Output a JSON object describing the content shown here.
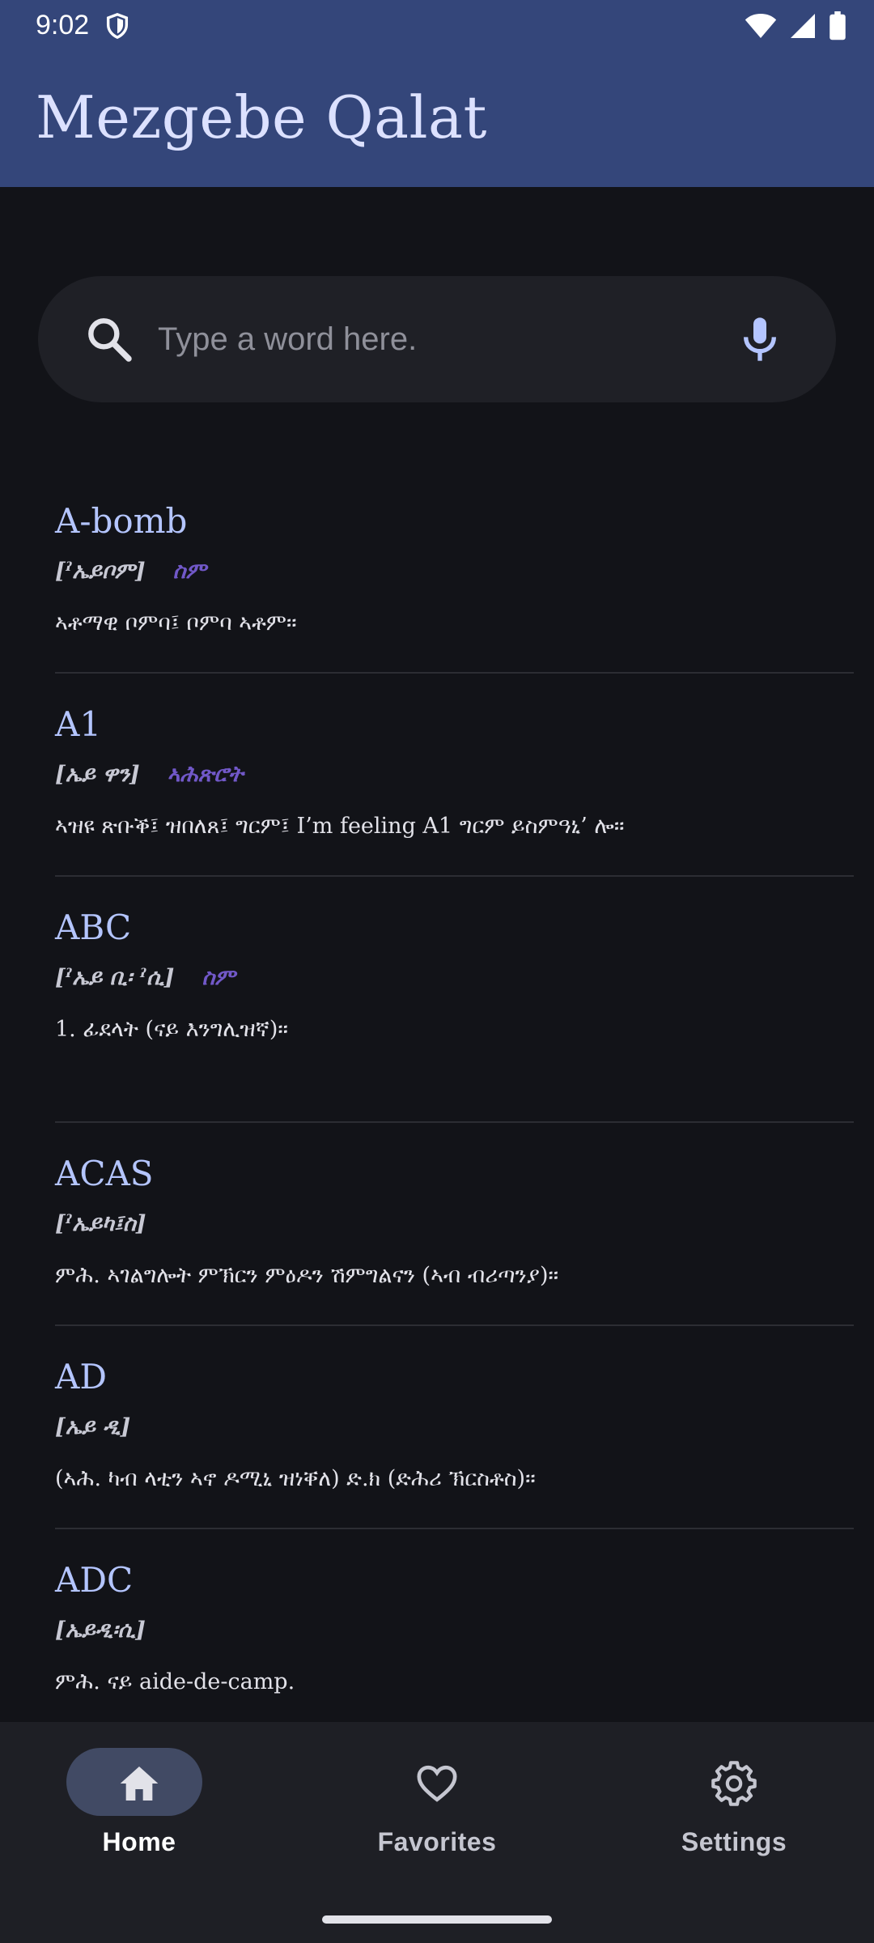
{
  "status_bar": {
    "time": "9:02",
    "icons": [
      "shield-icon",
      "wifi-icon",
      "signal-icon",
      "battery-icon"
    ]
  },
  "app_bar": {
    "title": "Mezgebe Qalat"
  },
  "search": {
    "placeholder": "Type a word here.",
    "value": "",
    "leading_icon": "search-icon",
    "trailing_icon": "mic-icon"
  },
  "entries": [
    {
      "word": "A-bomb",
      "pron": "[ˀኤይቦም]",
      "pos": "ስም",
      "def": "ኣቶማዊ ቦምባ፤ ቦምባ ኣቶም።"
    },
    {
      "word": "A1",
      "pron": "[ኤይ ዋን]",
      "pos": "ኣሕጽሮት",
      "def": "ኣዝዩ ጽቡቕ፤ ዝበለጸ፤ ግርም፤ I’m feeling A1 ግርም ይስምዓኒ’ ሎ።"
    },
    {
      "word": "ABC",
      "pron": "[ˀኤይ ቢ፡ ˀሲ]",
      "pos": "ስም",
      "def": "1. ፊደላት (ናይ እንግሊዝኛ)።"
    },
    {
      "word": "ACAS",
      "pron": "[ˀኤይካ፤ስ]",
      "pos": "",
      "def": "ምሕ. ኣገልግሎት ምኽርን ምዕዶን ሽምግልናን (ኣብ ብሪጣንያ)።"
    },
    {
      "word": "AD",
      "pron": "[ኤይ ዲ]",
      "pos": "",
      "def": "(ኣሕ. ካብ ላቲን ኣኖ ዶሚኒ ዝነቐለ) ድ.ክ (ድሕሪ ኽርስቶስ)።"
    },
    {
      "word": "ADC",
      "pron": "[ኤይዲ፡ሲ]",
      "pos": "",
      "def": "ምሕ. ናይ aide-de-camp."
    }
  ],
  "bottom_nav": {
    "items": [
      {
        "label": "Home",
        "icon": "home-icon",
        "active": true
      },
      {
        "label": "Favorites",
        "icon": "heart-icon",
        "active": false
      },
      {
        "label": "Settings",
        "icon": "gear-icon",
        "active": false
      }
    ]
  },
  "colors": {
    "app_bar": "#34467a",
    "background": "#121318",
    "word": "#b4c5ff",
    "part_of_speech": "#7158c8",
    "search_field": "#1f2026",
    "bottom_nav": "#1e1f25",
    "nav_active_pill": "#414a64"
  }
}
